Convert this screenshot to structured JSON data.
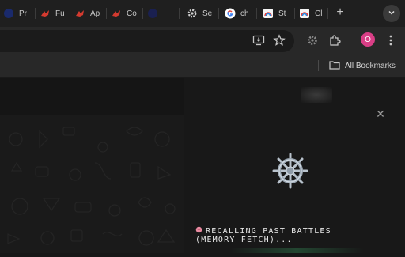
{
  "tabs": [
    {
      "label": "Pr",
      "icon": "globe-icon"
    },
    {
      "label": "Fu",
      "icon": "red-bird-icon"
    },
    {
      "label": "Ap",
      "icon": "red-bird-icon"
    },
    {
      "label": "Co",
      "icon": "red-bird-icon"
    },
    {
      "label": "",
      "icon": "dark-globe-icon"
    },
    {
      "label": "Se",
      "icon": "gear-icon"
    },
    {
      "label": "ch",
      "icon": "google-icon"
    },
    {
      "label": "St",
      "icon": "rainbow-icon"
    },
    {
      "label": "Cl",
      "icon": "rainbow-icon"
    }
  ],
  "tabstrip": {
    "new_tab_label": "+",
    "tab_search_label": "⌄"
  },
  "toolbar": {
    "avatar_initial": "O"
  },
  "bookmarks": {
    "all_label": "All Bookmarks"
  },
  "modal": {
    "close_label": "✕",
    "status_line1": "RECALLING PAST BATTLES",
    "status_line2": "(MEMORY FETCH)...",
    "status_icon": "brain-icon"
  },
  "colors": {
    "avatar": "#d93e86",
    "background": "#151515"
  }
}
